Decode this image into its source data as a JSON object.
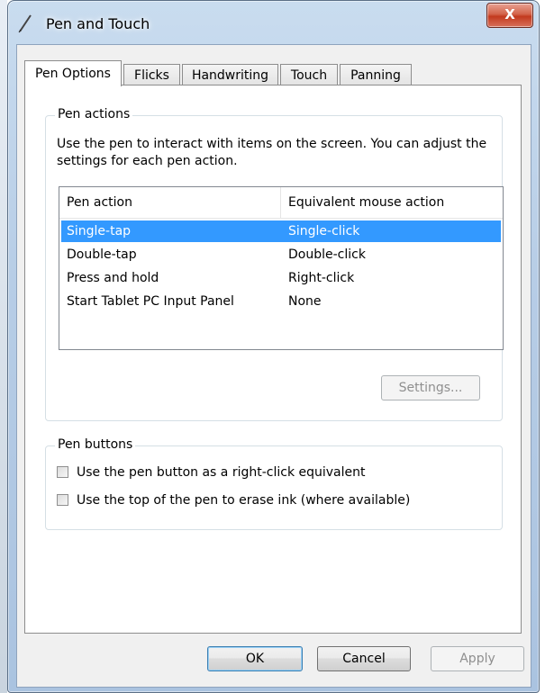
{
  "window": {
    "title": "Pen and Touch",
    "close_label": "X",
    "title_icon": "pen-icon"
  },
  "tabs": [
    {
      "label": "Pen Options",
      "active": true
    },
    {
      "label": "Flicks",
      "active": false
    },
    {
      "label": "Handwriting",
      "active": false
    },
    {
      "label": "Touch",
      "active": false
    },
    {
      "label": "Panning",
      "active": false
    }
  ],
  "pen_actions": {
    "group_label": "Pen actions",
    "description": "Use the pen to interact with items on the screen.  You can adjust the settings for each pen action.",
    "columns": [
      "Pen action",
      "Equivalent mouse action"
    ],
    "rows": [
      {
        "action": "Single-tap",
        "mouse": "Single-click",
        "selected": true
      },
      {
        "action": "Double-tap",
        "mouse": "Double-click",
        "selected": false
      },
      {
        "action": "Press and hold",
        "mouse": "Right-click",
        "selected": false
      },
      {
        "action": "Start Tablet PC Input Panel",
        "mouse": "None",
        "selected": false
      }
    ],
    "settings_button": "Settings..."
  },
  "pen_buttons": {
    "group_label": "Pen buttons",
    "options": [
      {
        "label": "Use the pen button as a right-click equivalent",
        "checked": false
      },
      {
        "label": "Use the top of the pen to erase ink (where available)",
        "checked": false
      }
    ]
  },
  "footer": {
    "ok": "OK",
    "cancel": "Cancel",
    "apply": "Apply"
  },
  "colors": {
    "selection": "#3399ff",
    "close_button": "#c23a1f"
  }
}
